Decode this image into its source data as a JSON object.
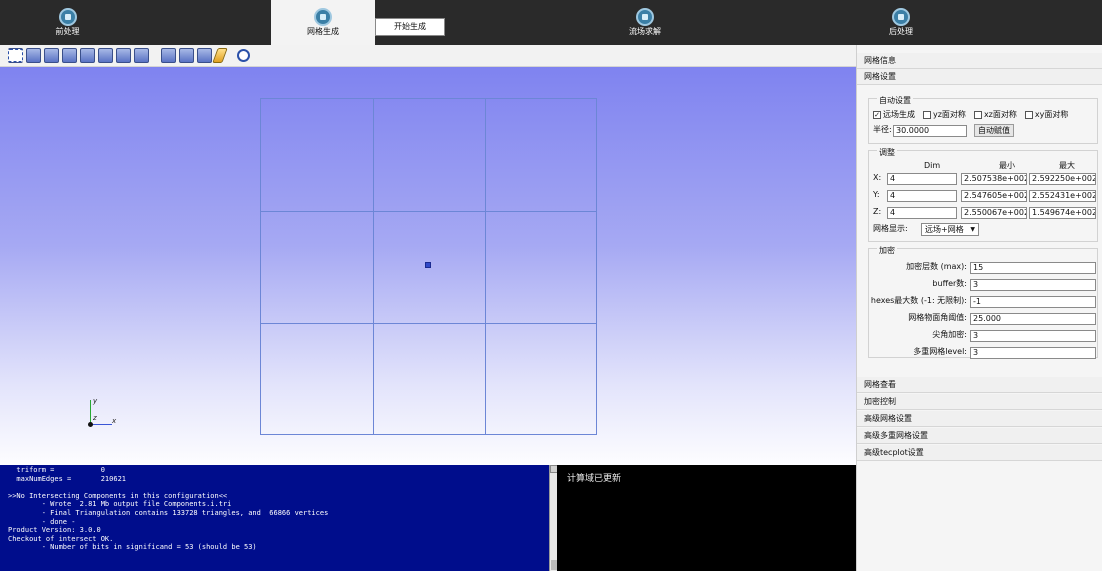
{
  "tabs": [
    {
      "label": "前处理"
    },
    {
      "label": "网格生成"
    },
    {
      "label": "流场求解"
    },
    {
      "label": "后处理"
    }
  ],
  "start_button": "开始生成",
  "toolbar": {
    "icons": [
      "cube-front-icon",
      "cube-back-icon",
      "cube-left-icon",
      "cube-right-icon",
      "cube-top-icon",
      "view-iso-icon",
      "view-iso2-icon",
      "view-iso3-icon",
      "cube-solid-icon",
      "cube-wire-icon",
      "cube-edge-icon",
      "pencil-icon",
      "select-box-icon",
      "select-all-icon",
      "target-icon"
    ]
  },
  "viewport": {
    "axis_labels": {
      "y": "y",
      "z": "z",
      "x": "x"
    }
  },
  "console": {
    "lines": [
      "  triform =           0",
      "  maxNumEdges =       210621",
      "",
      ">>No Intersecting Components in this configuration<<",
      "        - Wrote  2.81 Mb output file Components.i.tri",
      "        - Final Triangulation contains 133728 triangles, and  66866 vertices",
      "        - done -",
      "Product Version: 3.0.0",
      "Checkout of intersect OK.",
      "        - Number of bits in significand = 53 (should be 53)"
    ]
  },
  "output": {
    "text": "计算域已更新"
  },
  "panel": {
    "mesh_info": "网格信息",
    "mesh_settings": "网格设置",
    "auto": {
      "title": "自动设置",
      "farfield": "远场生成",
      "farfield_checked": true,
      "yz": "yz面对称",
      "xz": "xz面对称",
      "xy": "xy面对称",
      "radius_label": "半径:",
      "radius_value": "30.0000",
      "auto_button": "自动赋值"
    },
    "adjust": {
      "title": "调整",
      "col_dim": "Dim",
      "col_min": "最小",
      "col_max": "最大",
      "rows": [
        {
          "label": "X:",
          "dim": "4",
          "min": "2.507538e+002",
          "max": "2.592250e+002"
        },
        {
          "label": "Y:",
          "dim": "4",
          "min": "2.547605e+002",
          "max": "2.552431e+002"
        },
        {
          "label": "Z:",
          "dim": "4",
          "min": "2.550067e+002",
          "max": "1.549674e+002"
        }
      ],
      "display_label": "网格显示:",
      "display_value": "远场+网格"
    },
    "refine": {
      "title": "加密",
      "rows": [
        {
          "label": "加密层数 (max):",
          "value": "15"
        },
        {
          "label": "buffer数:",
          "value": "3"
        },
        {
          "label": "hexes最大数 (-1: 无限制):",
          "value": "-1"
        },
        {
          "label": "网格物面角阈值:",
          "value": "25.000"
        },
        {
          "label": "尖角加密:",
          "value": "3"
        },
        {
          "label": "多重网格level:",
          "value": "3"
        }
      ]
    },
    "bottom_sections": [
      "网格查看",
      "加密控制",
      "高级网格设置",
      "高级多重网格设置",
      "高级tecplot设置"
    ]
  },
  "colors": {
    "topbar": "#2a2a2a",
    "console_bg": "#000d8c",
    "viewport_top": "#7f83f0",
    "grid_line": "#6c86d6"
  }
}
